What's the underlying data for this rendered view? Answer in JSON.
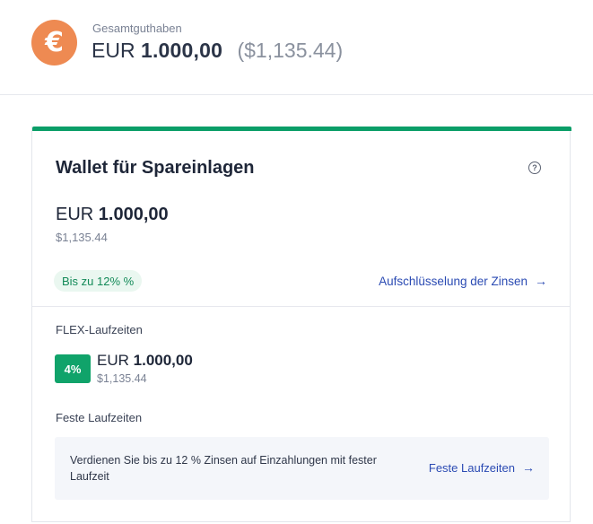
{
  "header": {
    "icon": "euro-icon",
    "icon_glyph": "€",
    "icon_color": "#ee8a52",
    "label": "Gesamtguthaben",
    "currency": "EUR",
    "amount": "1.000,00",
    "usd": "($1,135.44)"
  },
  "card": {
    "accent_color": "#0a9e68",
    "title": "Wallet für Spareinlagen",
    "help_glyph": "?",
    "currency": "EUR",
    "amount": "1.000,00",
    "usd": "$1,135.44",
    "badge": "Bis zu 12% %",
    "interest_link": "Aufschlüsselung der Zinsen",
    "arrow_glyph": "→"
  },
  "flex": {
    "label": "FLEX-Laufzeiten",
    "rate": "4%",
    "currency": "EUR",
    "amount": "1.000,00",
    "usd": "$1,135.44"
  },
  "fixed": {
    "label": "Feste Laufzeiten",
    "description": "Verdienen Sie bis zu 12 % Zinsen auf Einzahlungen mit fester Laufzeit",
    "link": "Feste Laufzeiten",
    "arrow_glyph": "→"
  }
}
